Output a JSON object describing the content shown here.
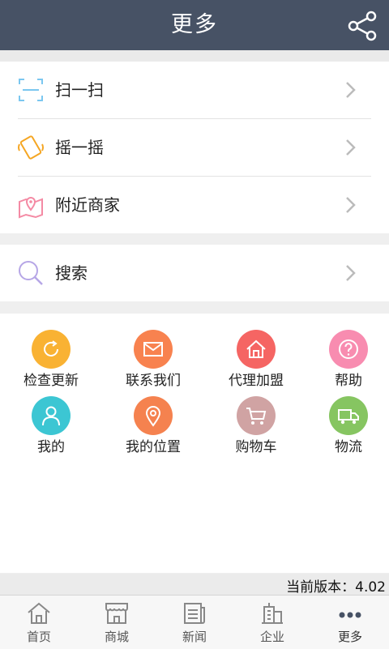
{
  "header": {
    "title": "更多"
  },
  "menu": [
    {
      "label": "扫一扫",
      "icon": "scan-icon"
    },
    {
      "label": "摇一摇",
      "icon": "shake-phone-icon"
    },
    {
      "label": "附近商家",
      "icon": "map-location-icon"
    }
  ],
  "search": {
    "label": "搜索",
    "icon": "search-icon"
  },
  "grid": [
    {
      "label": "检查更新",
      "icon": "refresh-icon",
      "color": "#f9b233"
    },
    {
      "label": "联系我们",
      "icon": "mail-icon",
      "color": "#f8824f"
    },
    {
      "label": "代理加盟",
      "icon": "home-icon",
      "color": "#f56563"
    },
    {
      "label": "帮助",
      "icon": "help-icon",
      "color": "#f88cb0"
    },
    {
      "label": "我的",
      "icon": "user-icon",
      "color": "#3cc6d3"
    },
    {
      "label": "我的位置",
      "icon": "location-pin-icon",
      "color": "#f5824f"
    },
    {
      "label": "购物车",
      "icon": "cart-icon",
      "color": "#d0a3a3"
    },
    {
      "label": "物流",
      "icon": "truck-icon",
      "color": "#86c561"
    }
  ],
  "version": {
    "text": "当前版本：4.02"
  },
  "tabs": [
    {
      "label": "首页",
      "icon": "home-tab-icon",
      "active": false
    },
    {
      "label": "商城",
      "icon": "store-icon",
      "active": false
    },
    {
      "label": "新闻",
      "icon": "news-icon",
      "active": false
    },
    {
      "label": "企业",
      "icon": "building-icon",
      "active": false
    },
    {
      "label": "更多",
      "icon": "more-dots-icon",
      "active": true
    }
  ],
  "colors": {
    "header_bg": "#475265",
    "accent_tab": "#475265"
  }
}
